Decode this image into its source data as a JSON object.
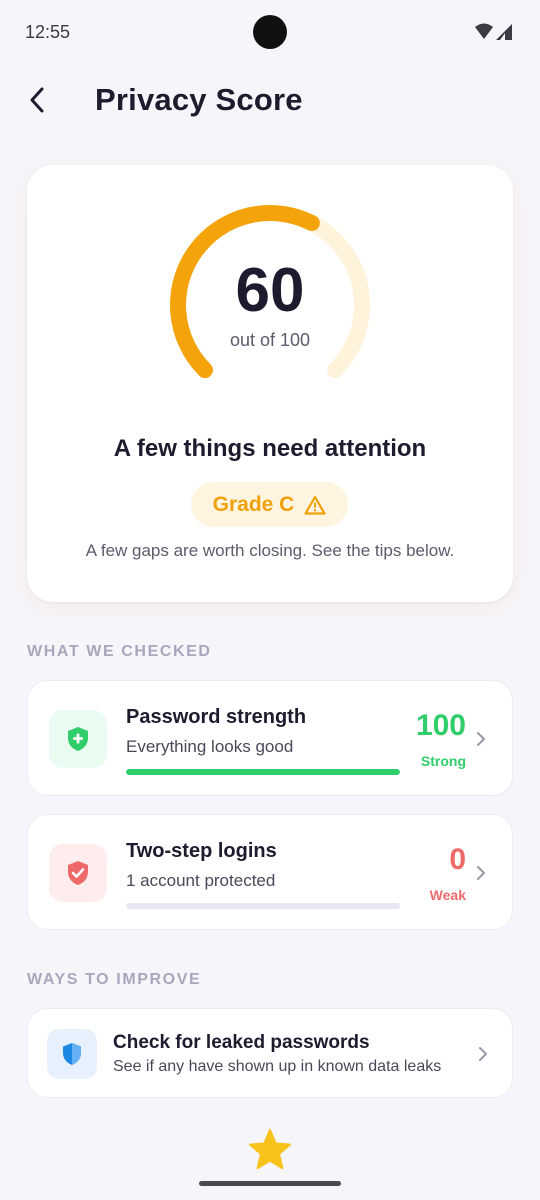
{
  "status_bar": {
    "time": "12:55"
  },
  "header": {
    "title": "Privacy Score"
  },
  "score": {
    "value": "60",
    "out_of_label": "out of 100",
    "fraction": 0.6,
    "headline": "A few things need attention",
    "grade": "Grade C",
    "subtext": "A few gaps are worth closing. See the tips below."
  },
  "sections": {
    "checked": "WHAT WE CHECKED",
    "improve": "WAYS TO IMPROVE"
  },
  "checks": [
    {
      "title": "Password strength",
      "description": "Everything looks good",
      "score": "100",
      "strength": "Strong",
      "progress": 1.0,
      "icon": "shield-plus-icon"
    },
    {
      "title": "Two-step logins",
      "description": "1 account protected",
      "score": "0",
      "strength": "Weak",
      "progress": 0.0,
      "icon": "shield-check-icon"
    }
  ],
  "improve": {
    "title": "Check for leaked passwords",
    "description": "See if any have shown up in known data leaks",
    "icon": "shield-icon"
  },
  "colors": {
    "accent": "#F5A30A",
    "strong": "#2FCE6B",
    "weak": "#EE6A6A",
    "info": "#1E88E5"
  },
  "bottom_nav": {
    "icon": "star-icon"
  }
}
